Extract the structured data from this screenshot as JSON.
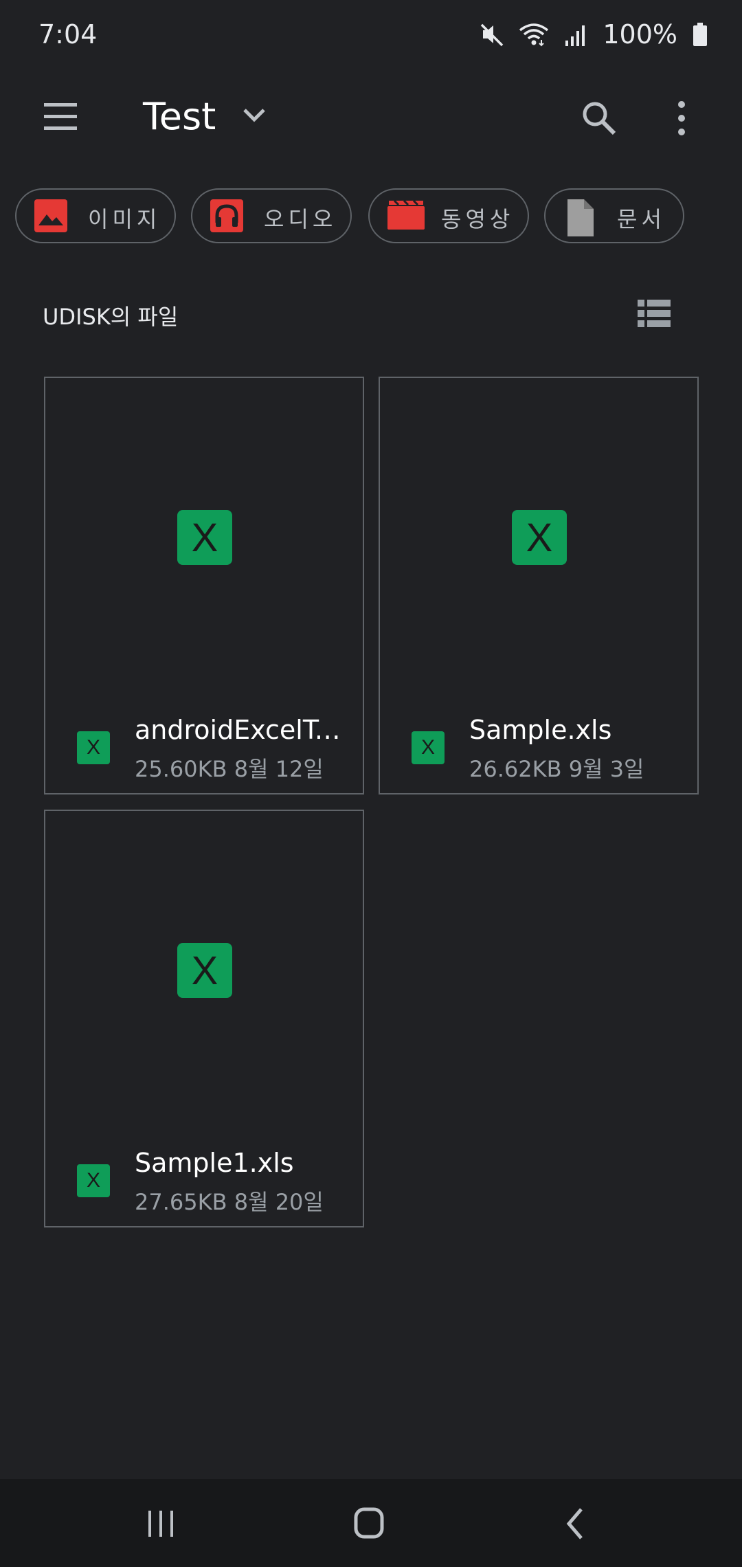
{
  "status_bar": {
    "time": "7:04",
    "battery": "100%",
    "icons": [
      "mute-icon",
      "wifi-icon",
      "signal-icon",
      "battery-icon"
    ]
  },
  "app_bar": {
    "title": "Test",
    "icons": [
      "menu-icon",
      "chevron-down-icon",
      "search-icon",
      "more-vert-icon"
    ]
  },
  "categories": [
    {
      "label": "이미지",
      "icon": "image-icon",
      "color": "#e53935"
    },
    {
      "label": "오디오",
      "icon": "headphones-icon",
      "color": "#e53935"
    },
    {
      "label": "동영상",
      "icon": "video-icon",
      "color": "#e53935"
    },
    {
      "label": "문서",
      "icon": "document-icon",
      "color": "#9e9e9e"
    }
  ],
  "section": {
    "title": "UDISK의 파일",
    "view_toggle_icon": "list-view-icon"
  },
  "files": [
    {
      "name": "androidExcelTe...",
      "meta": "25.60KB 8월 12일",
      "icon_letter": "X"
    },
    {
      "name": "Sample.xls",
      "meta": "26.62KB 9월 3일",
      "icon_letter": "X"
    },
    {
      "name": "Sample1.xls",
      "meta": "27.65KB 8월 20일",
      "icon_letter": "X"
    }
  ],
  "colors": {
    "background": "#202124",
    "excel_green": "#0f9d58",
    "accent_red": "#e53935"
  },
  "nav_bar": {
    "icons": [
      "recent-apps-icon",
      "home-icon",
      "back-icon"
    ]
  }
}
